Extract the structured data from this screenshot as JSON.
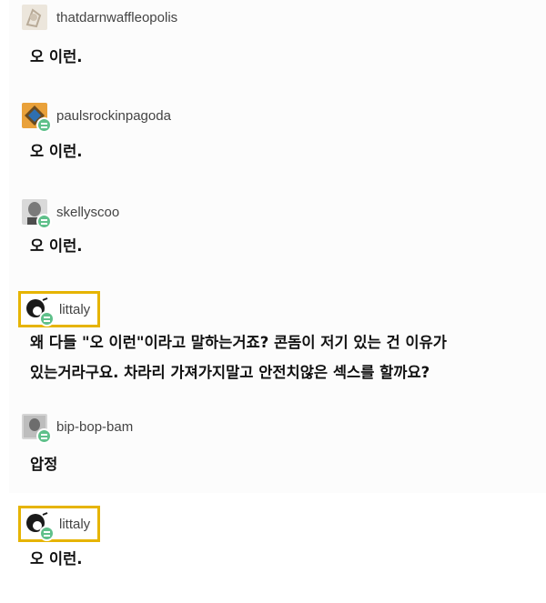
{
  "posts": [
    {
      "username": "thatdarnwaffleopolis",
      "text": "오 이런."
    },
    {
      "username": "paulsrockinpagoda",
      "text": "오 이런."
    },
    {
      "username": "skellyscoo",
      "text": "오 이런."
    },
    {
      "username": "littaly",
      "text_line1": "왜 다들 \"오 이런\"이라고 말하는거죠? 콘돔이 저기 있는 건 이유가",
      "text_line2": "있는거라구요. 차라리 가져가지말고 안전치않은 섹스를 할까요?"
    },
    {
      "username": "bip-bop-bam",
      "text": "압정"
    },
    {
      "username": "littaly",
      "text": "오 이런."
    }
  ],
  "colors": {
    "highlight": "#e6b400",
    "badge": "#5fc08a"
  },
  "icons": [
    "avatar-waffle",
    "avatar-pagoda",
    "avatar-skelly",
    "avatar-littaly",
    "avatar-bip",
    "reblog-badge-icon"
  ]
}
